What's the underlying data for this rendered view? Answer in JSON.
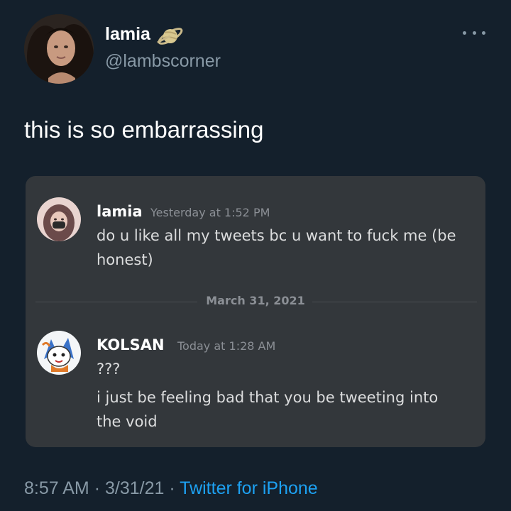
{
  "tweet": {
    "display_name": "lamia",
    "handle": "@lambscorner",
    "text": "this is so embarrassing",
    "badge_icon": "saturn-planet-icon",
    "more_icon": "more-options-icon"
  },
  "embedded_chat": {
    "messages": [
      {
        "author": "lamia",
        "timestamp": "Yesterday at 1:52 PM",
        "lines": [
          "do u like all my tweets bc u want to fuck me (be",
          "honest)"
        ]
      },
      {
        "author": "KOLSAN",
        "timestamp": "Today at 1:28 AM",
        "lines": [
          "???",
          "i just be feeling bad that you be tweeting into",
          "the void"
        ]
      }
    ],
    "date_divider": "March 31, 2021"
  },
  "footer": {
    "time": "8:57 AM",
    "separator": "·",
    "date": "3/31/21",
    "source": "Twitter for iPhone"
  },
  "colors": {
    "background": "#14202c",
    "card": "#33373b",
    "link": "#1da1f2",
    "secondary_text": "#8899a6"
  }
}
